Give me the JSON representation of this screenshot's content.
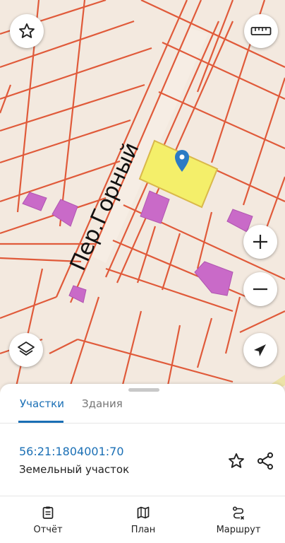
{
  "map": {
    "street_label": "Пер.Горный",
    "colors": {
      "background": "#f3e9df",
      "boundary": "#e05a3a",
      "selected_parcel": "#f4ef6a",
      "building": "#c96ac8",
      "marker": "#2b7bc4"
    },
    "controls": {
      "favorite": "star-icon",
      "ruler": "ruler-icon",
      "zoom_in": "plus-icon",
      "zoom_out": "minus-icon",
      "layers": "layers-icon",
      "location": "navigation-arrow-icon"
    }
  },
  "sheet": {
    "tabs": [
      {
        "label": "Участки",
        "active": true
      },
      {
        "label": "Здания",
        "active": false
      }
    ],
    "parcel": {
      "cadastral_number": "56:21:1804001:70",
      "type": "Земельный участок"
    },
    "actions": [
      "star-icon",
      "share-icon"
    ]
  },
  "bottom_nav": [
    {
      "label": "Отчёт",
      "icon": "report-icon"
    },
    {
      "label": "План",
      "icon": "map-plan-icon"
    },
    {
      "label": "Маршрут",
      "icon": "route-icon"
    }
  ]
}
